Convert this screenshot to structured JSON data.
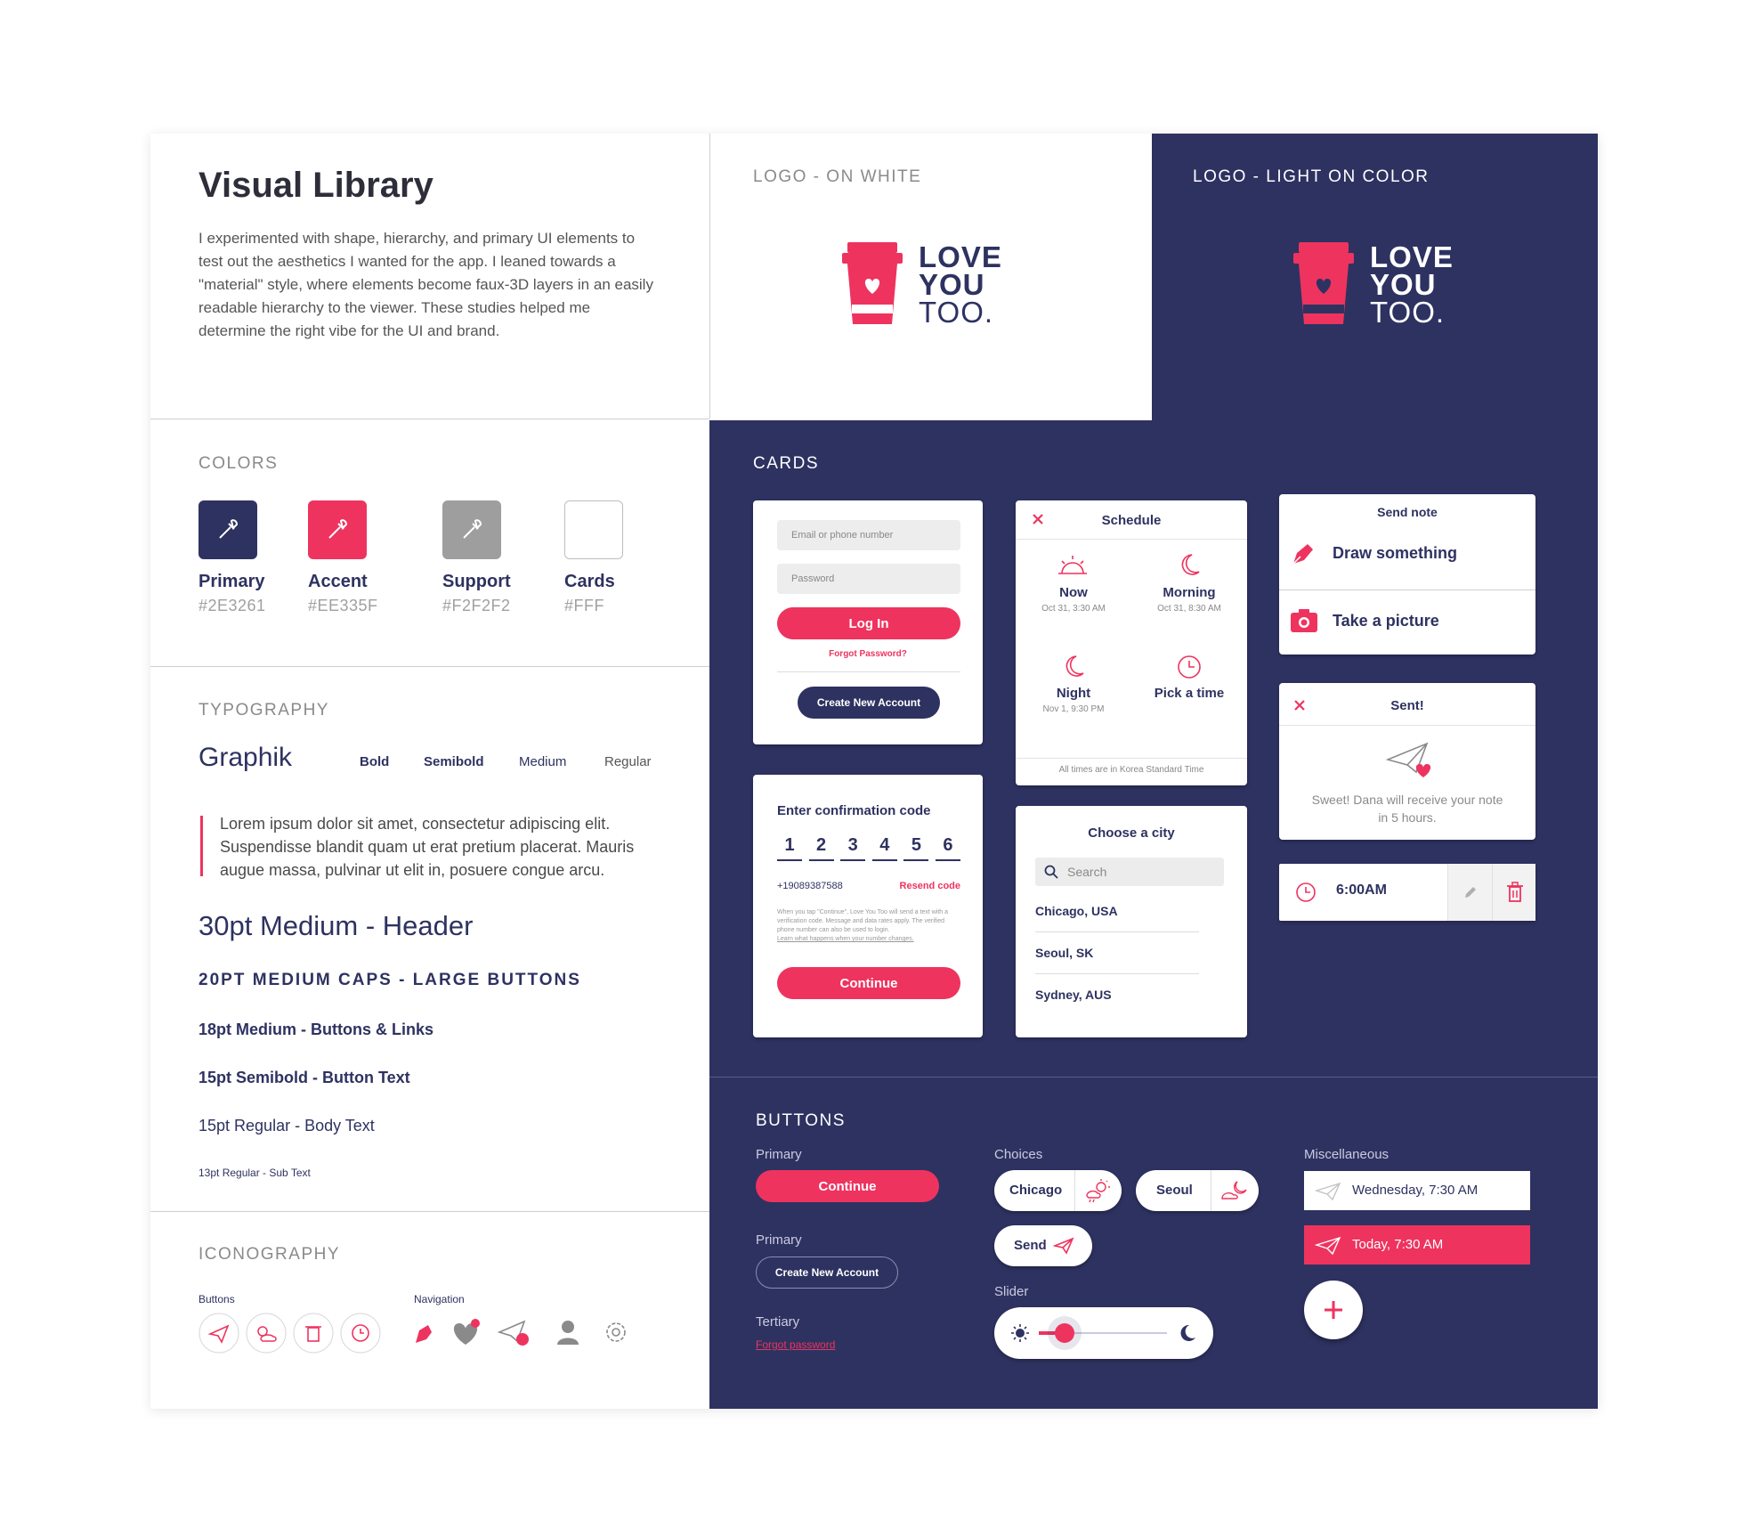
{
  "intro": {
    "title": "Visual Library",
    "body": "I experimented with shape, hierarchy, and primary UI elements to test out the aesthetics I wanted for the app. I leaned towards a \"material\" style, where elements become faux-3D layers in an easily readable hierarchy to the viewer. These studies helped me determine the right vibe for the UI and brand."
  },
  "logo": {
    "on_white_label": "LOGO - ON WHITE",
    "on_color_label": "LOGO - LIGHT ON COLOR",
    "line1": "LOVE",
    "line2": "YOU",
    "line3": "TOO."
  },
  "colors": {
    "label": "COLORS",
    "items": [
      {
        "name": "Primary",
        "hex": "#2E3261"
      },
      {
        "name": "Accent",
        "hex": "#EE335F"
      },
      {
        "name": "Support",
        "hex": "#F2F2F2"
      },
      {
        "name": "Cards",
        "hex": "#FFF"
      }
    ]
  },
  "typography": {
    "label": "TYPOGRAPHY",
    "font_name": "Graphik",
    "weights": [
      "Bold",
      "Semibold",
      "Medium",
      "Regular"
    ],
    "quote": "Lorem ipsum dolor sit amet, consectetur adipiscing elit. Suspendisse blandit quam ut erat pretium placerat. Mauris augue massa, pulvinar ut elit in, posuere congue arcu.",
    "header": "30pt Medium - Header",
    "caps": "20PT MEDIUM CAPS - LARGE BUTTONS",
    "links": "18pt Medium - Buttons & Links",
    "button_text": "15pt Semibold - Button Text",
    "body_text": "15pt Regular - Body Text",
    "sub_text": "13pt Regular - Sub Text"
  },
  "iconography": {
    "label": "ICONOGRAPHY",
    "buttons_label": "Buttons",
    "navigation_label": "Navigation"
  },
  "cards": {
    "label": "CARDS",
    "login": {
      "email_placeholder": "Email or phone number",
      "password_placeholder": "Password",
      "login": "Log In",
      "forgot": "Forgot Password?",
      "create": "Create New Account"
    },
    "schedule": {
      "title": "Schedule",
      "options": [
        {
          "label": "Now",
          "sub": "Oct 31, 3:30 AM"
        },
        {
          "label": "Morning",
          "sub": "Oct 31, 8:30 AM"
        },
        {
          "label": "Night",
          "sub": "Nov 1, 9:30 PM"
        },
        {
          "label": "Pick a time",
          "sub": ""
        }
      ],
      "footer": "All times are in Korea Standard Time"
    },
    "send_note": {
      "title": "Send note",
      "draw": "Draw something",
      "picture": "Take a picture"
    },
    "sent": {
      "title": "Sent!",
      "message": "Sweet! Dana will receive your note in 5 hours."
    },
    "alarm": {
      "time": "6:00AM"
    },
    "confirm": {
      "title": "Enter confirmation code",
      "digits": [
        "1",
        "2",
        "3",
        "4",
        "5",
        "6"
      ],
      "phone": "+19089387588",
      "resend": "Resend code",
      "fine_print": "When you tap \"Continue\", Love You Too will send a text with a verification code. Message and data rates apply. The verified phone number can also be used to login.",
      "fine_link": "Learn what happens when your number changes.",
      "continue": "Continue"
    },
    "city": {
      "title": "Choose a city",
      "search_placeholder": "Search",
      "items": [
        "Chicago, USA",
        "Seoul, SK",
        "Sydney, AUS"
      ]
    }
  },
  "buttons": {
    "label": "BUTTONS",
    "primary_label": "Primary",
    "primary_button": "Continue",
    "primary2_label": "Primary",
    "primary2_button": "Create New Account",
    "tertiary_label": "Tertiary",
    "tertiary_link": "Forgot password",
    "choices_label": "Choices",
    "choices": [
      "Chicago",
      "Seoul"
    ],
    "send": "Send",
    "slider_label": "Slider",
    "slider_value": 0.2,
    "misc_label": "Miscellaneous",
    "misc_items": [
      "Wednesday, 7:30 AM",
      "Today, 7:30 AM"
    ]
  },
  "palette": {
    "primary": "#2E3261",
    "accent": "#EE335F",
    "support": "#F2F2F2",
    "cards": "#FFFFFF"
  }
}
